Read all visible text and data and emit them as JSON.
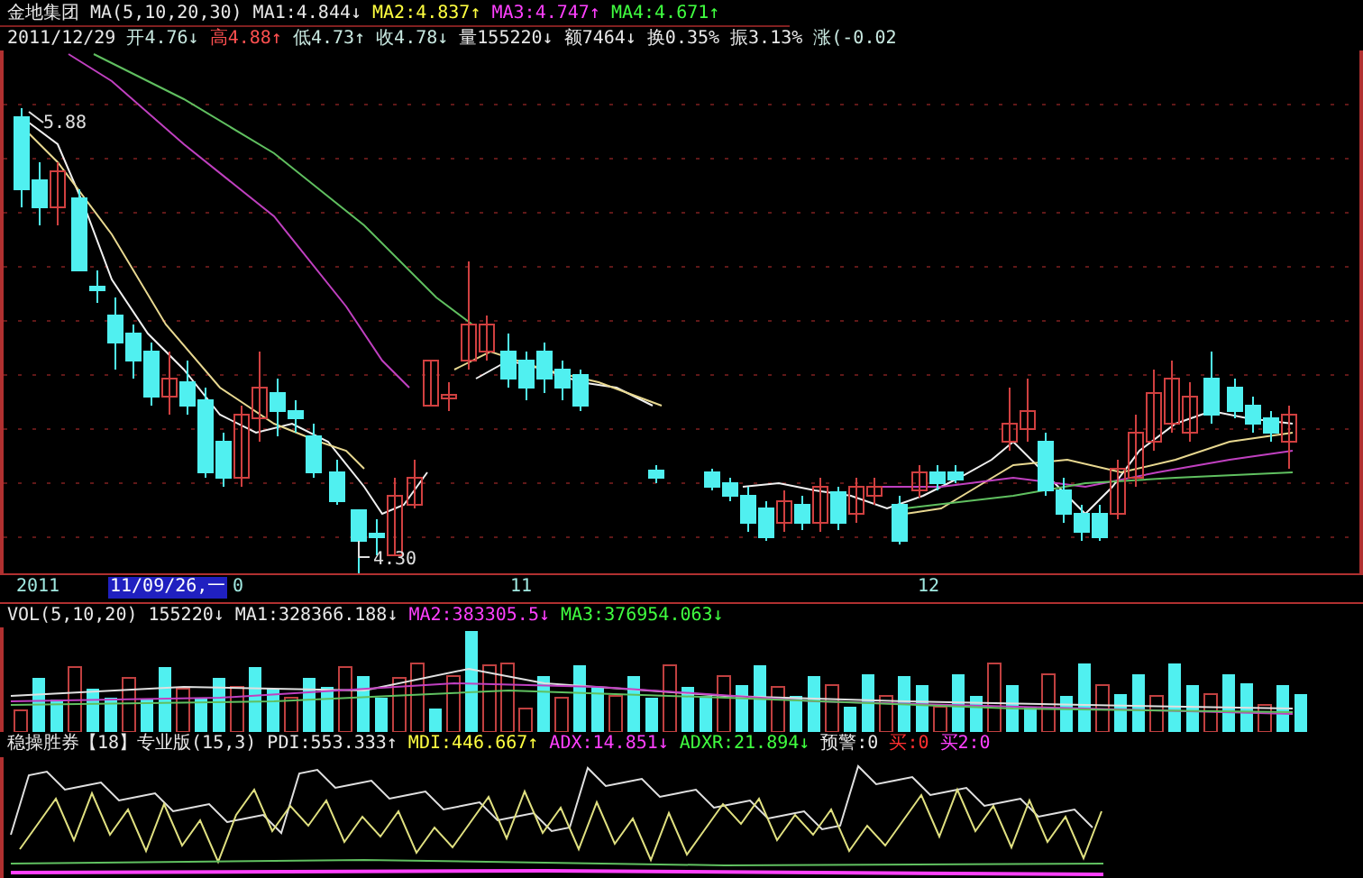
{
  "quote_header": {
    "title_line": [
      {
        "text": "金地集团",
        "color": "#e8e8e8"
      },
      {
        "text": "MA(5,10,20,30)",
        "color": "#e8e8e8"
      },
      {
        "text": "MA1:4.844↓",
        "color": "#e8e8e8"
      },
      {
        "text": "MA2:4.837↑",
        "color": "#ffff40"
      },
      {
        "text": "MA3:4.747↑",
        "color": "#ff40ff"
      },
      {
        "text": "MA4:4.671↑",
        "color": "#40ff40"
      }
    ],
    "price_line": [
      {
        "text": "2011/12/29",
        "color": "#e8e8e8"
      },
      {
        "text": "开4.76↓",
        "color": "#c8e8e0"
      },
      {
        "text": "高4.88↑",
        "color": "#ff5050"
      },
      {
        "text": "低4.73↑",
        "color": "#c8e8e0"
      },
      {
        "text": "收4.78↓",
        "color": "#c8e8e0"
      },
      {
        "text": "量155220↓",
        "color": "#e8e8e8"
      },
      {
        "text": "额7464↓",
        "color": "#e8e8e8"
      },
      {
        "text": "换0.35%",
        "color": "#e8e8e8"
      },
      {
        "text": "振3.13%",
        "color": "#e8e8e8"
      },
      {
        "text": "涨(-0.02",
        "color": "#c8e8e0"
      }
    ]
  },
  "main_chart": {
    "high_label": "5.88",
    "low_label": "4.30"
  },
  "time_axis": {
    "labels": [
      {
        "text": "2011",
        "selected": false
      },
      {
        "text": "11/09/26,一",
        "selected": true
      },
      {
        "text": "0",
        "selected": false
      },
      {
        "text": "11",
        "selected": false
      },
      {
        "text": "12",
        "selected": false
      }
    ]
  },
  "volume_panel": {
    "legend": [
      {
        "text": "VOL(5,10,20)",
        "color": "#e8e8e8"
      },
      {
        "text": "155220↓",
        "color": "#e8e8e8"
      },
      {
        "text": "MA1:328366.188↓",
        "color": "#e8e8e8"
      },
      {
        "text": "MA2:383305.5↓",
        "color": "#ff40ff"
      },
      {
        "text": "MA3:376954.063↓",
        "color": "#40ff40"
      }
    ]
  },
  "indicator_panel": {
    "legend": [
      {
        "text": "稳操胜券【18】专业版(15,3)",
        "color": "#e8e8e8"
      },
      {
        "text": "PDI:553.333↑",
        "color": "#e8e8e8"
      },
      {
        "text": "MDI:446.667↑",
        "color": "#ffff40"
      },
      {
        "text": "ADX:14.851↓",
        "color": "#ff40ff"
      },
      {
        "text": "ADXR:21.894↓",
        "color": "#40ff40"
      },
      {
        "text": "预警:0",
        "color": "#e8e8e8"
      },
      {
        "text": "买:0",
        "color": "#ff3030"
      },
      {
        "text": "买2:0",
        "color": "#ff40ff"
      }
    ]
  }
}
